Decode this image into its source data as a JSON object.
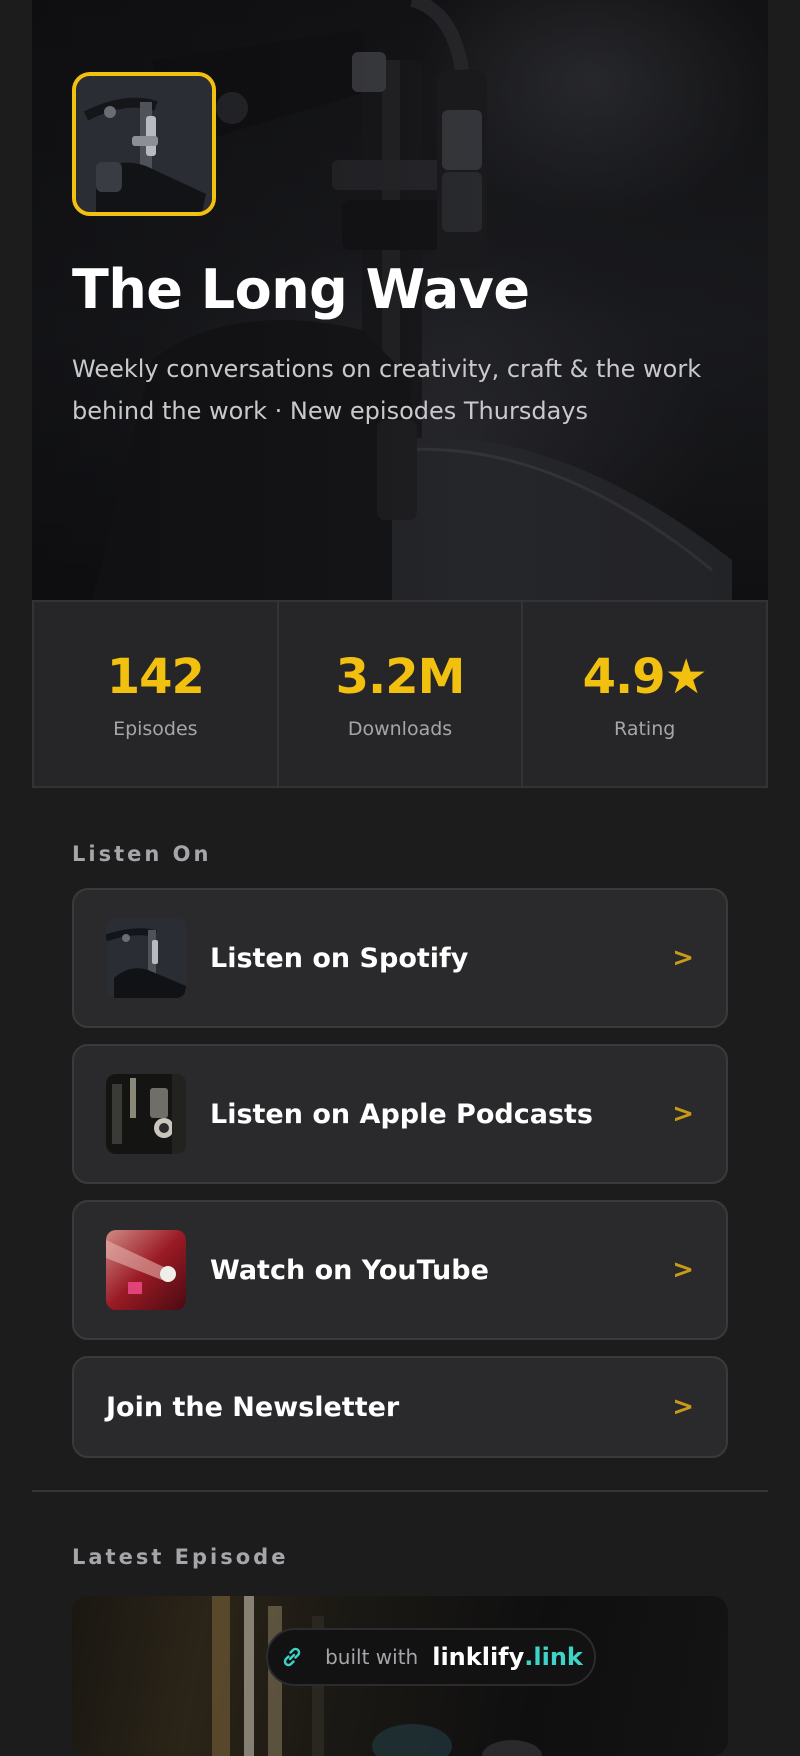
{
  "profile": {
    "title": "The Long Wave",
    "subtitle": "Weekly conversations on creativity, craft & the work behind the work · New episodes Thursdays",
    "avatar_icon": "microphone-photo",
    "accent_color": "#f2c10f"
  },
  "stats": [
    {
      "value": "142",
      "label": "Episodes"
    },
    {
      "value": "3.2M",
      "label": "Downloads"
    },
    {
      "value": "4.9★",
      "label": "Rating"
    }
  ],
  "listen_on": {
    "heading": "Listen On",
    "links": [
      {
        "label": "Listen on Spotify",
        "thumb": "microphone-photo",
        "chevron": ">"
      },
      {
        "label": "Listen on Apple Podcasts",
        "thumb": "studio-photo",
        "chevron": ">"
      },
      {
        "label": "Watch on YouTube",
        "thumb": "red-lens-photo",
        "chevron": ">"
      },
      {
        "label": "Join the Newsletter",
        "chevron": ">"
      }
    ]
  },
  "latest_episode": {
    "heading": "Latest Episode"
  },
  "footer_badge": {
    "prefix": "built with",
    "brand": "linklify",
    "tld": ".link",
    "icon": "link-icon",
    "tld_color": "#3fd2c7"
  }
}
